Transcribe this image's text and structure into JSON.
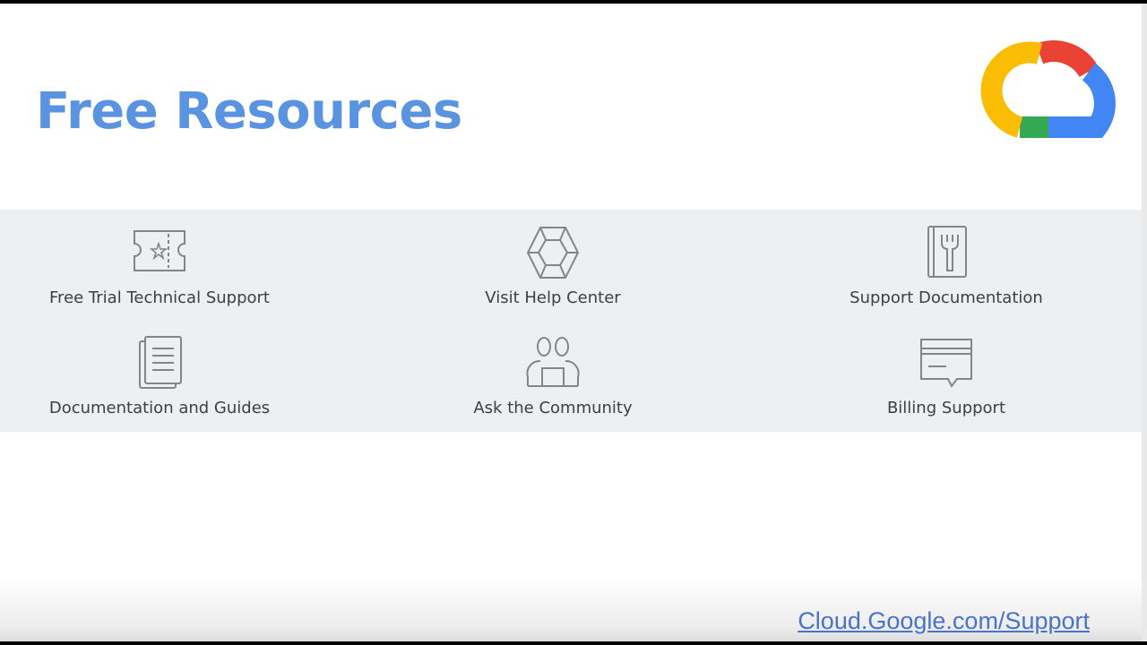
{
  "slide": {
    "title": "Free Resources",
    "logo_icon": "google-cloud-logo",
    "link_text": "Cloud.Google.com/Support"
  },
  "colors": {
    "title": "#5a93e0",
    "band": "#eeeff1",
    "icon_stroke": "#80868b",
    "link": "#4a72c9",
    "logo_red": "#ea4335",
    "logo_blue": "#4285f4",
    "logo_yellow": "#fbbc04",
    "logo_green": "#34a853"
  },
  "resources": [
    {
      "label": "Free Trial Technical Support",
      "icon": "ticket-star-icon"
    },
    {
      "label": "Visit Help Center",
      "icon": "help-center-icon"
    },
    {
      "label": "Support Documentation",
      "icon": "wrench-document-icon"
    },
    {
      "label": "Documentation and Guides",
      "icon": "document-lines-icon"
    },
    {
      "label": "Ask the Community",
      "icon": "community-people-icon"
    },
    {
      "label": "Billing Support",
      "icon": "billing-card-icon"
    }
  ]
}
